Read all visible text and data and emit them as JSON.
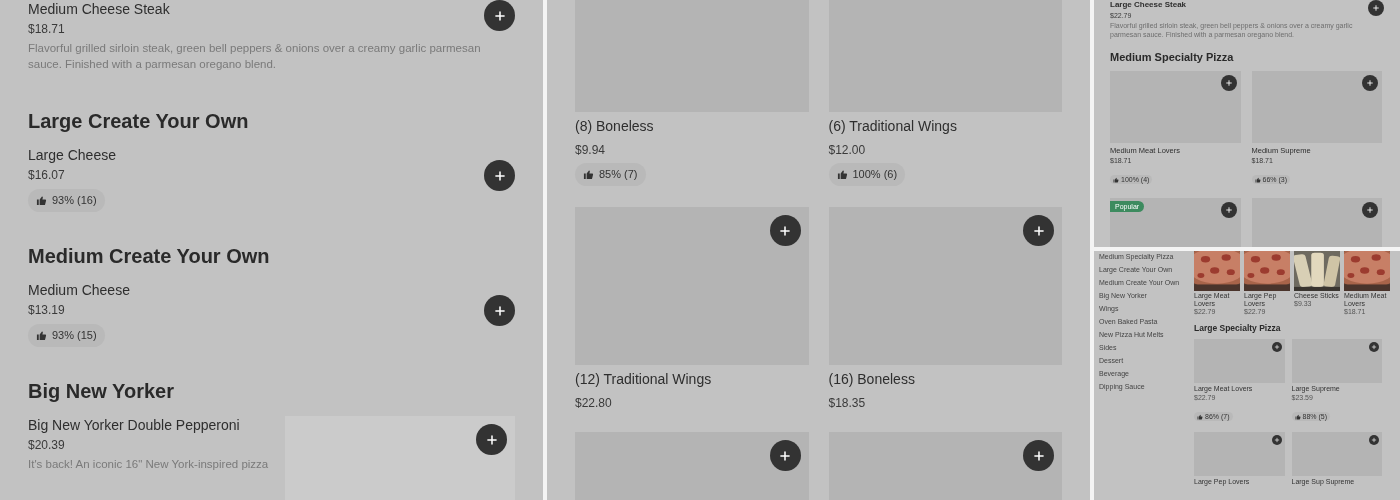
{
  "panel_1": {
    "sections": [
      {
        "items": [
          {
            "name": "Medium Cheese Steak",
            "price": "$18.71",
            "description": "Flavorful grilled sirloin steak, green bell peppers & onions over a creamy garlic parmesan sauce. Finished with a parmesan oregano blend."
          }
        ]
      },
      {
        "title": "Large Create Your Own",
        "items": [
          {
            "name": "Large Cheese",
            "price": "$16.07",
            "rating": "93% (16)"
          }
        ]
      },
      {
        "title": "Medium Create Your Own",
        "items": [
          {
            "name": "Medium Cheese",
            "price": "$13.19",
            "rating": "93% (15)"
          }
        ]
      },
      {
        "title": "Big New Yorker",
        "items": [
          {
            "name": "Big New Yorker Double Pepperoni",
            "price": "$20.39",
            "description": "It's back! An iconic 16\" New York-inspired pizza",
            "kind": "with_image"
          }
        ]
      }
    ]
  },
  "panel_2": {
    "cards": [
      {
        "kind": "product",
        "name": "(8) Boneless",
        "price": "$9.94",
        "rating": "85% (7)"
      },
      {
        "kind": "product",
        "name": "(6) Traditional Wings",
        "price": "$12.00",
        "rating": "100% (6)"
      },
      {
        "kind": "product",
        "name": "(12) Traditional Wings",
        "price": "$22.80"
      },
      {
        "kind": "product",
        "name": "(16) Boneless",
        "price": "$18.35"
      },
      {
        "kind": "picture"
      },
      {
        "kind": "picture"
      }
    ]
  },
  "panel_3": {
    "item": {
      "name": "Large Cheese Steak",
      "price": "$22.79",
      "description": "Flavorful grilled sirloin steak, green bell peppers & onions over a creamy garlic parmesan sauce. Finished with a parmesan oregano blend."
    },
    "section": {
      "title": "Medium Specialty Pizza",
      "cards": [
        {
          "kind": "product",
          "name": "Medium Meat Lovers",
          "price": "$18.71",
          "rating": "100% (4)"
        },
        {
          "kind": "product",
          "name": "Medium Supreme",
          "price": "$18.71",
          "rating": "66% (3)"
        },
        {
          "kind": "picture",
          "badge": "Popular",
          "color": "#3d8b5f"
        },
        {
          "kind": "picture"
        }
      ]
    }
  },
  "panel_4": {
    "sidebar": {
      "items": [
        "Medium Specialty Pizza",
        "Large Create Your Own",
        "Medium Create Your Own",
        "Big New Yorker",
        "Wings",
        "Oven Baked Pasta",
        "New Pizza Hut Melts",
        "Sides",
        "Dessert",
        "Beverage",
        "Dipping Sauce"
      ]
    },
    "carousel": [
      {
        "name": "Large Meat Lovers",
        "price": "$22.79",
        "kind": "pizza"
      },
      {
        "name": "Large Pep Lovers",
        "price": "$22.79",
        "kind": "pizza"
      },
      {
        "name": "Cheese Sticks",
        "price": "$9.33",
        "kind": "sticks"
      },
      {
        "name": "Medium Meat Lovers",
        "price": "$18.71",
        "kind": "pizza"
      }
    ],
    "section": {
      "title": "Large Specialty Pizza",
      "cards": [
        {
          "kind": "product",
          "name": "Large Meat Lovers",
          "price": "$22.79",
          "rating": "86% (7)"
        },
        {
          "kind": "product",
          "name": "Large Supreme",
          "price": "$23.59",
          "rating": "88% (5)"
        },
        {
          "kind": "product",
          "name": "Large Pep Lovers"
        },
        {
          "kind": "product",
          "name": "Large Sup Supreme"
        }
      ]
    }
  }
}
